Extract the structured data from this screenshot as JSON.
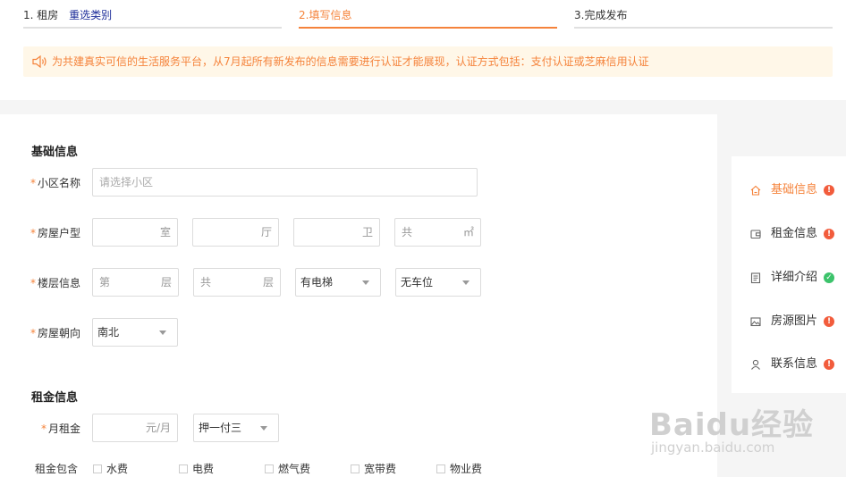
{
  "steps": {
    "step1": "1. 租房",
    "step1_link": "重选类别",
    "step2": "2.填写信息",
    "step3": "3.完成发布"
  },
  "notice": "为共建真实可信的生活服务平台，从7月起所有新发布的信息需要进行认证才能展现，认证方式包括：支付认证或芝麻信用认证",
  "basic": {
    "title": "基础信息",
    "community_label": "小区名称",
    "community_placeholder": "请选择小区",
    "layout_label": "房屋户型",
    "room_unit": "室",
    "hall_unit": "厅",
    "bath_unit": "卫",
    "area_prefix": "共",
    "area_unit": "㎡",
    "floor_label": "楼层信息",
    "floor_prefix": "第",
    "floor_unit": "层",
    "total_prefix": "共",
    "total_unit": "层",
    "elevator_value": "有电梯",
    "parking_value": "无车位",
    "orientation_label": "房屋朝向",
    "orientation_value": "南北"
  },
  "rent": {
    "title": "租金信息",
    "monthly_label": "月租金",
    "monthly_unit": "元/月",
    "payment_value": "押一付三",
    "include_label": "租金包含",
    "options": [
      "水费",
      "电费",
      "燃气费",
      "宽带费",
      "物业费"
    ]
  },
  "nav": {
    "items": [
      {
        "label": "基础信息",
        "status": "!"
      },
      {
        "label": "租金信息",
        "status": "!"
      },
      {
        "label": "详细介绍",
        "status": "✓"
      },
      {
        "label": "房源图片",
        "status": "!"
      },
      {
        "label": "联系信息",
        "status": "!"
      }
    ]
  },
  "watermark": {
    "brand": "Baidu经验",
    "url": "jingyan.baidu.com"
  },
  "colors": {
    "accent": "#f5833b",
    "link": "#1e2e9a",
    "error": "#f25c3c",
    "success": "#3cc36b"
  }
}
